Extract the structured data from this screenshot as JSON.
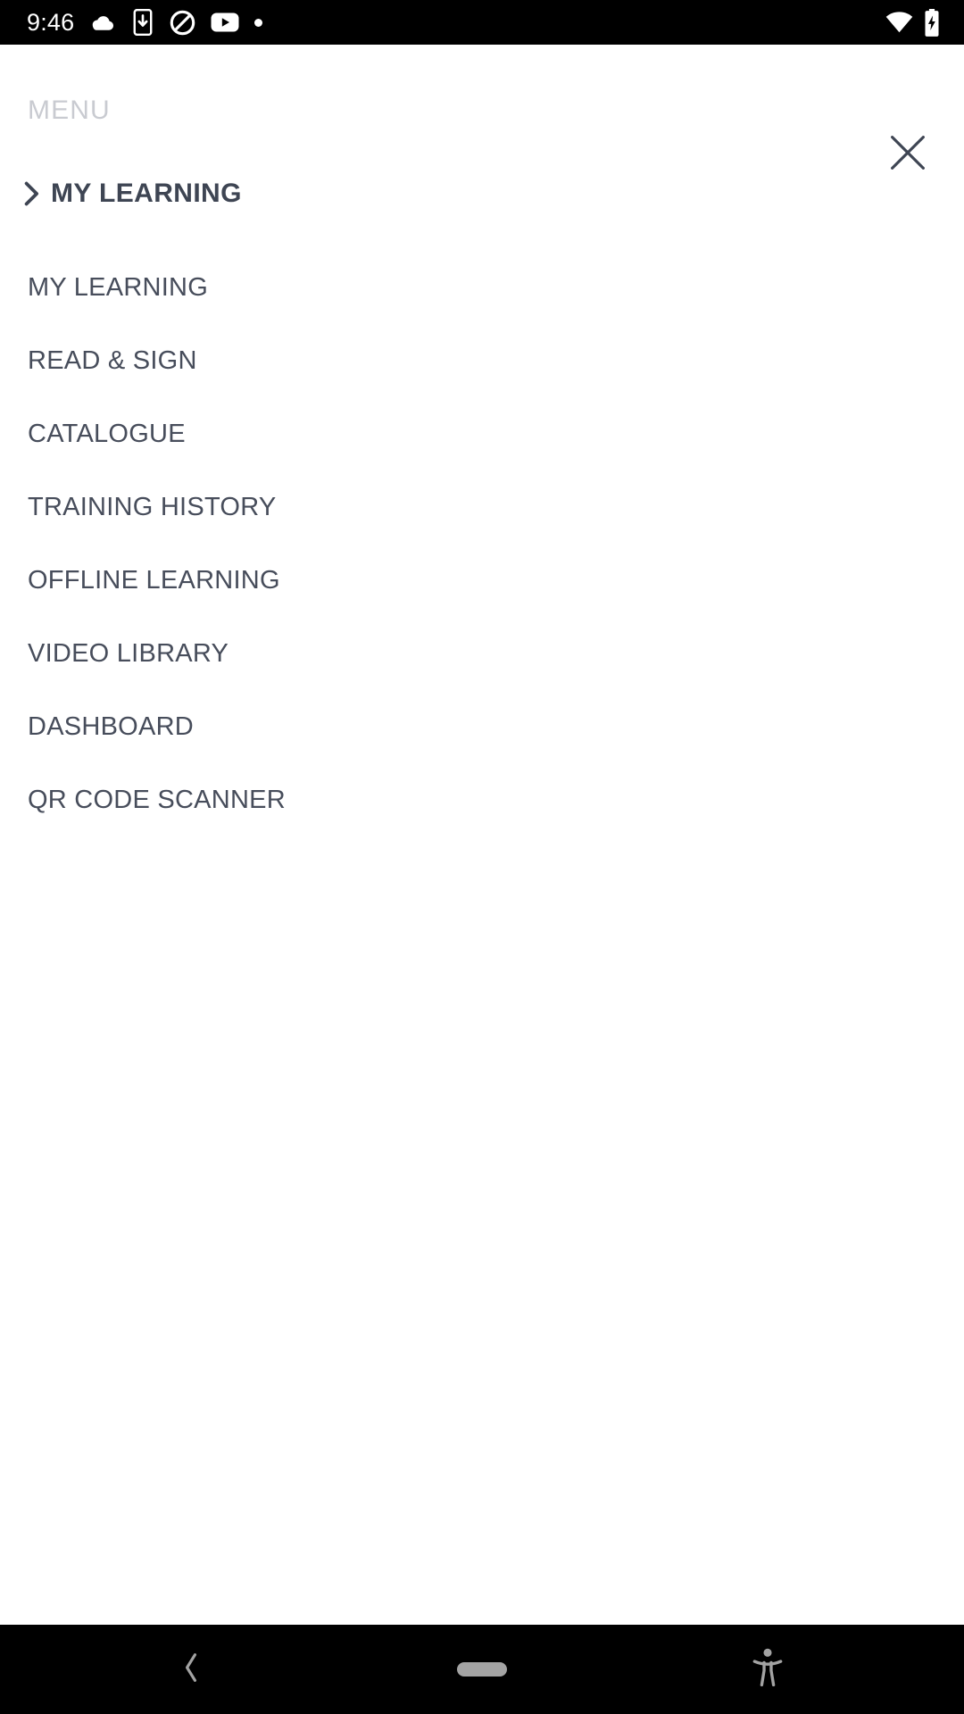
{
  "status_bar": {
    "time": "9:46",
    "left_icons": [
      {
        "name": "cloud-icon",
        "label": "cloud"
      },
      {
        "name": "phone-download-icon",
        "label": "download to device"
      },
      {
        "name": "do-not-disturb-icon",
        "label": "do not disturb"
      },
      {
        "name": "youtube-icon",
        "label": "youtube"
      },
      {
        "name": "more-dot-icon",
        "label": "more notifications"
      }
    ],
    "right_icons": [
      {
        "name": "wifi-icon",
        "label": "wifi"
      },
      {
        "name": "battery-charging-icon",
        "label": "battery charging"
      }
    ],
    "background": "#000000",
    "foreground": "#ffffff"
  },
  "menu": {
    "title": "MENU",
    "title_color": "#c9cbd1",
    "close_label": "Close menu",
    "close_icon": "close-icon",
    "section": {
      "label": "MY LEARNING",
      "expanded": true,
      "chevron_icon": "chevron-right-icon",
      "color": "#3e4553"
    },
    "items": [
      {
        "label": "MY LEARNING"
      },
      {
        "label": "READ & SIGN"
      },
      {
        "label": "CATALOGUE"
      },
      {
        "label": "TRAINING HISTORY"
      },
      {
        "label": "OFFLINE LEARNING"
      },
      {
        "label": "VIDEO LIBRARY"
      },
      {
        "label": "DASHBOARD"
      },
      {
        "label": "QR CODE SCANNER"
      }
    ],
    "item_color": "#474d5b",
    "background": "#ffffff"
  },
  "nav_bar": {
    "background": "#000000",
    "tint": "#a3a3a3",
    "buttons": [
      {
        "name": "nav-back-button",
        "label": "Back",
        "icon": "chevron-left-icon"
      },
      {
        "name": "nav-home-button",
        "label": "Home",
        "icon": "home-pill-icon"
      },
      {
        "name": "nav-accessibility-button",
        "label": "Accessibility",
        "icon": "accessibility-icon"
      }
    ]
  }
}
